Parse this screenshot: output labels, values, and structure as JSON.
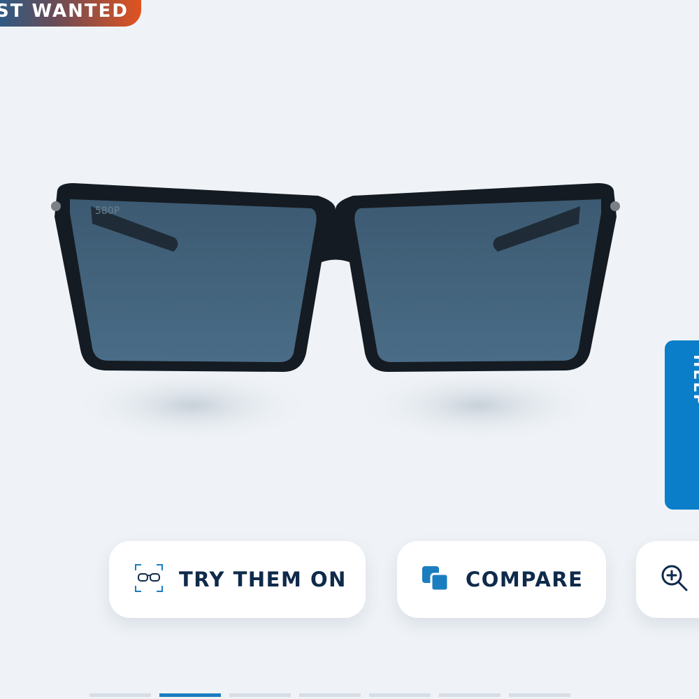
{
  "badge": {
    "text": "ST WANTED"
  },
  "product": {
    "lens_marking": "580P"
  },
  "side_tab": {
    "text": "HELP"
  },
  "actions": {
    "try_on_label": "TRY THEM ON",
    "compare_label": "COMPARE",
    "zoom_icon": "zoom-in-icon"
  },
  "carousel": {
    "slide_count": 7,
    "active_index": 1
  },
  "colors": {
    "accent_blue": "#0b7ec9",
    "text_navy": "#0f2a4a",
    "background": "#eff3f7",
    "badge_gradient_start": "#1f5f8e",
    "badge_gradient_end": "#e0531f"
  }
}
